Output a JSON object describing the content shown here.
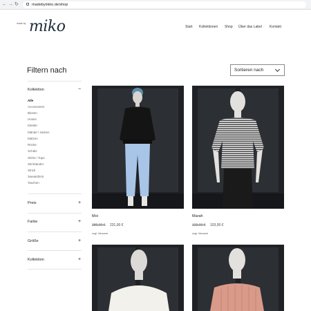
{
  "browser": {
    "back_icon": "back-arrow-icon",
    "forward_icon": "forward-arrow-icon",
    "reload_icon": "reload-icon",
    "url": "madebymiko.de/shop"
  },
  "header": {
    "logo_small": "made by",
    "logo": "miko",
    "nav": [
      "Start",
      "Kollektionen",
      "Shop",
      "Über das Label",
      "Kontakt"
    ]
  },
  "page": {
    "title": "Filtern nach",
    "sort_label": "Sortieren nach"
  },
  "sidebar": {
    "sections": [
      {
        "label": "Kollektion",
        "sign": "−"
      },
      {
        "label": "Preis",
        "sign": "+"
      },
      {
        "label": "Farbe",
        "sign": "+"
      },
      {
        "label": "Größe",
        "sign": "+"
      },
      {
        "label": "Kollektion",
        "sign": "+"
      }
    ],
    "categories": [
      "Alle",
      "Accessoires",
      "Blusen",
      "Hosen",
      "Kleider",
      "Mäntel / Jacken",
      "Mützen",
      "Röcke",
      "Schals",
      "Shirts / Tops",
      "Stirnbänder",
      "Strick",
      "Sweatshirts",
      "Taschen"
    ]
  },
  "products": [
    {
      "name": "Moi",
      "old_price": "289,00 €",
      "price": "231,00 €",
      "shipping": "zzgl. Versand"
    },
    {
      "name": "Marah",
      "old_price": "129,00 €",
      "price": "103,00 €",
      "shipping": "zzgl. Versand"
    }
  ],
  "colors": {
    "brand": "#1d2c3a",
    "studio_bg": "#1f2125"
  }
}
